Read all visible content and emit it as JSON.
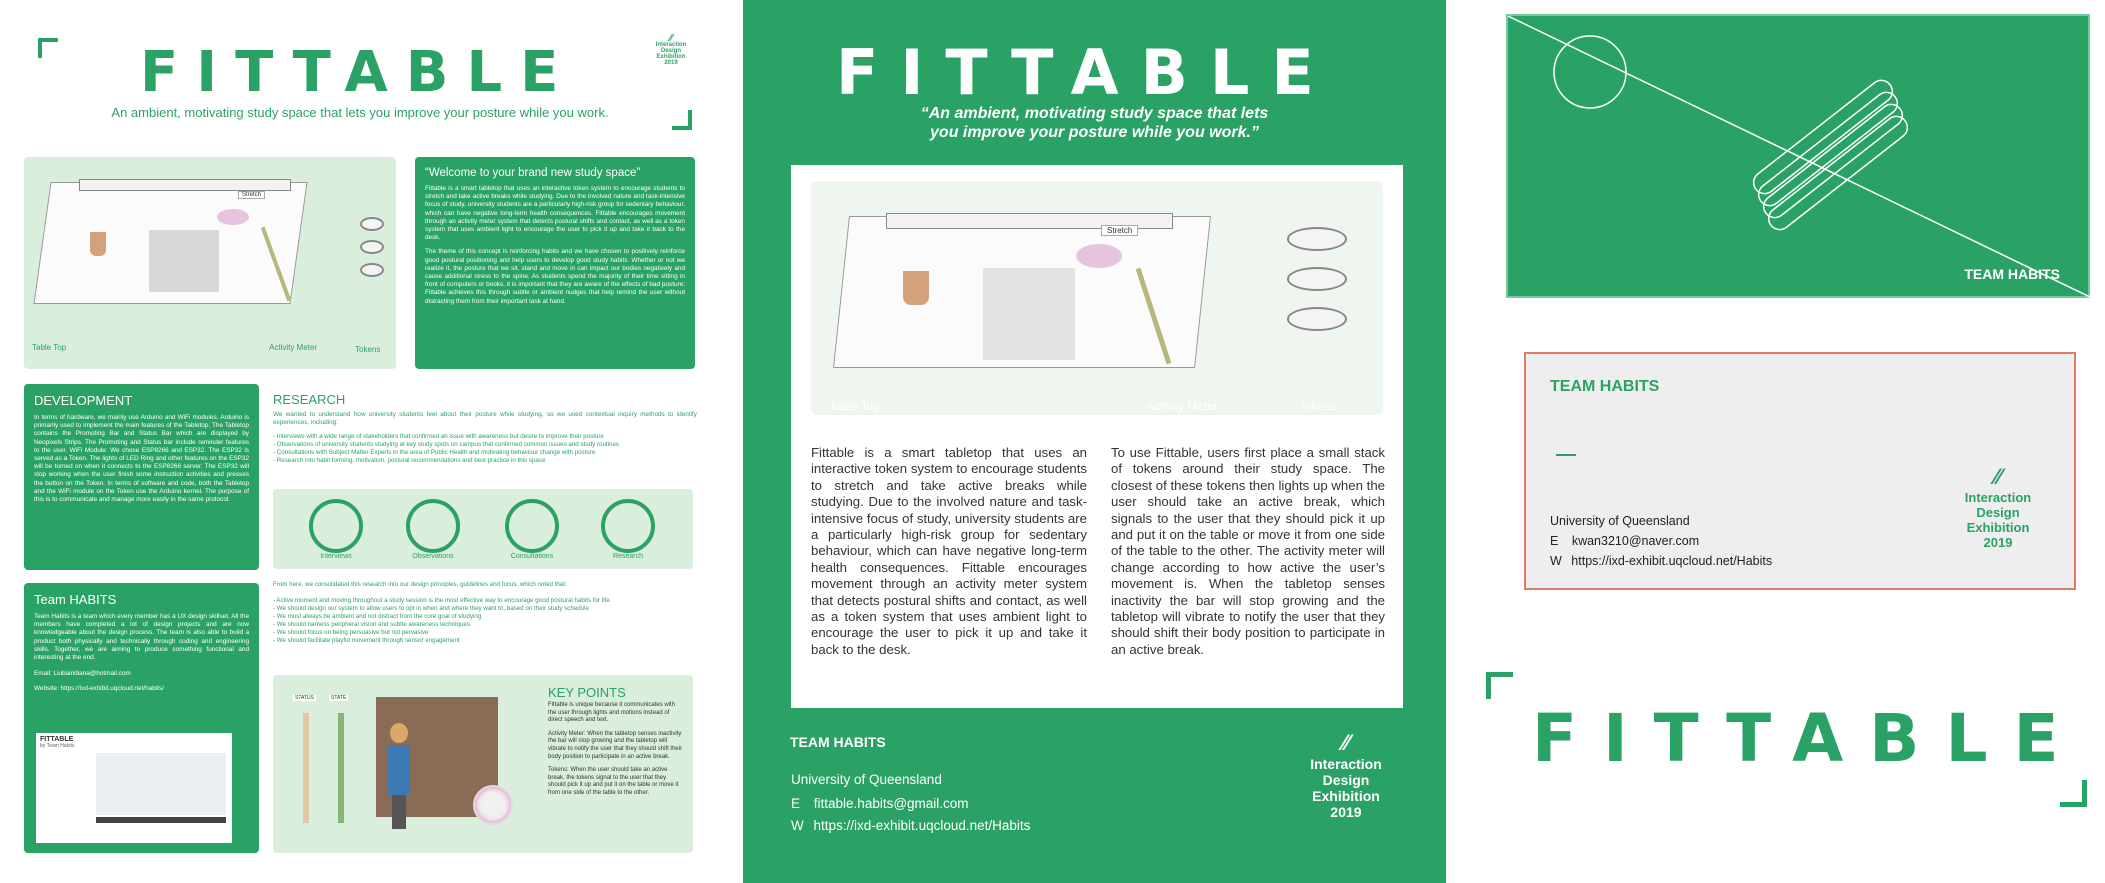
{
  "brand": {
    "logo_text": "FITTABLE",
    "team": "TEAM HABITS"
  },
  "exhibition": {
    "line1": "Interaction",
    "line2": "Design",
    "line3": "Exhibition",
    "year": "2019"
  },
  "poster1": {
    "tagline": "An ambient, motivating study space that lets you improve your posture while you work.",
    "welcome_title": "“Welcome to your brand new study space”",
    "welcome_p1": "Fittable is a smart tabletop that uses an interactive token system to encourage students to stretch and take active breaks while studying. Due to the involved nature and task-intensive focus of study, university students are a particularly high-risk group for sedentary behaviour, which can have negative long-term health consequences. Fittable encourages movement through an activity meter system that detects postural shifts and contact, as well as a token system that uses ambient light to encourage the user to pick it up and take it back to the desk.",
    "welcome_p2": "The theme of this concept is reinforcing habits and we have chosen to positively reinforce good postural positioning and help users to develop good study habits. Whether or not we realize it, the posture that we sit, stand and move in can impact our bodies negatively and cause additional stress to the spine. As students spend the majority of their time sitting in front of computers or books, it is important that they are aware of the effects of bad posture; Fittable achieves this through subtle or ambient nudges that help remind the user without distracting them from their important task at hand.",
    "labels": {
      "table_top": "Table Top",
      "activity_meter": "Activity Meter",
      "tokens": "Tokens",
      "stretch": "Stretch"
    },
    "development_title": "DEVELOPMENT",
    "development_text": "In terms of hardware, we mainly use Arduino and WiFi modules. Arduino is primarily used to implement the main features of the Tabletop. The Tabletop contains the Promoting Bar and Status Bar which are displayed by Neopixels Strips. The Promoting and Status bar include reminder features to the user. WiFi Module: We chose ESP8266 and ESP32. The ESP32 is served as a Token. The lights of LED Ring and other features on the ESP32 will be turned on when it connects to the ESP8266 server. The ESP32 will stop working when the user finish some instruction activities and presses the button on the Token. In terms of software and code, both the Tabletop and the WiFi module on the Token use the Arduino kernel. The purpose of this is to communicate and manage more easily in the same protocol.",
    "research_title": "RESEARCH",
    "research_intro": "We wanted to understand how university students feel about their posture while studying, so we used contextual inquiry methods to identify experiences, including:",
    "research_items": [
      "- Interviews with a wide range of stakeholders that confirmed an issue with awareness but desire to improve their posture",
      "- Observations of university students studying at key study spots on campus that confirmed common issues and study routines",
      "- Consultations with Subject Matter Experts in the area of Public Health and motivating behaviour change with posture",
      "- Research into habit forming, motivation, postural recommendations and best practice in this space"
    ],
    "research_icons": [
      "Interviews",
      "Observations",
      "Consultations",
      "Research"
    ],
    "team_title": "Team HABITS",
    "team_text": "Team Habits is a team which every member has a UX design skillset. All the members have completed a lot of design projects and are now knowledgeable about the design process. The team is also able to build a product both physically and technically through coding and engineering skills. Together, we are aiming to produce something functional and interesting at the end.",
    "team_email": "Email: Liubaindiana@hotmail.com",
    "team_website": "Website: https://ixd-exhibit.uqcloud.net/habits/",
    "principles_intro": "From here, we consolidated this research into our design principles, guidelines and focus, which noted that:",
    "principles": [
      "- Active moment and moving throughout a study session is the most effective way to encourage good postural habits for life.",
      "- We should design our system to allow users to opt in when and where they want to, based on their study schedule",
      "- We must always be ambient and not distract from the core goal of studying",
      "- We should harness peripheral vision and subtle awareness techniques",
      "- We should focus on being persuasive but not pervasive",
      "- We should facilitate playful movement through sensor engagement"
    ],
    "keypoints_title": "KEY POINTS",
    "keypoints_p1": "Fittable is unique because it communicates with the user through lights and motions instead of direct speech and text.",
    "keypoints_p2": "Activity Meter: When the tabletop senses inactivity the bar will stop growing and the tabletop will vibrate to notify the user that they should shift their body position to participate in an active break.",
    "keypoints_p3": "Tokens: When the user should take an active break, the tokens signal to the user that they should pick it up and put it on the table or move it from one side of the table to the other.",
    "bar_labels": [
      "STATUS",
      "STATE"
    ],
    "video_title": "FITTABLE",
    "video_sub": "by Team Habits"
  },
  "poster2": {
    "tagline_line1": "“An ambient, motivating study space that lets",
    "tagline_line2": "you improve your posture while you work.”",
    "col1": "Fittable is a smart tabletop that uses an interactive token system to encourage students to stretch and take active breaks while studying. Due to the involved nature and task-intensive focus of study, university students are a particularly high-risk group for sedentary behaviour, which can have negative long-term health consequences. Fittable encourages movement through an activity meter system that detects postural shifts and contact, as well as a token system that uses ambient light to encourage the user to pick it up and take it back to the desk.",
    "col2": "To use Fittable, users first place a small stack of tokens around their study space. The closest of these tokens then lights up when the user should take an active break, which signals to the user that they should pick it up and put it on the table or move it from one side of the table to the other. The activity meter will change according to how active the user’s movement is. When the tabletop senses inactivity the bar will stop growing and the tabletop will vibrate to notify the user that they should shift their body position to participate in an active break.",
    "university": "University of Queensland",
    "email_label": "E",
    "email": "fittable.habits@gmail.com",
    "web_label": "W",
    "web": "https://ixd-exhibit.uqcloud.net/Habits"
  },
  "card": {
    "university": "University of Queensland",
    "email_label": "E",
    "email": "kwan3210@naver.com",
    "web_label": "W",
    "web": "https://ixd-exhibit.uqcloud.net/Habits"
  },
  "colors": {
    "green": "#2ba265",
    "light_green": "#d9eedd",
    "card_border": "#e07a6a"
  }
}
